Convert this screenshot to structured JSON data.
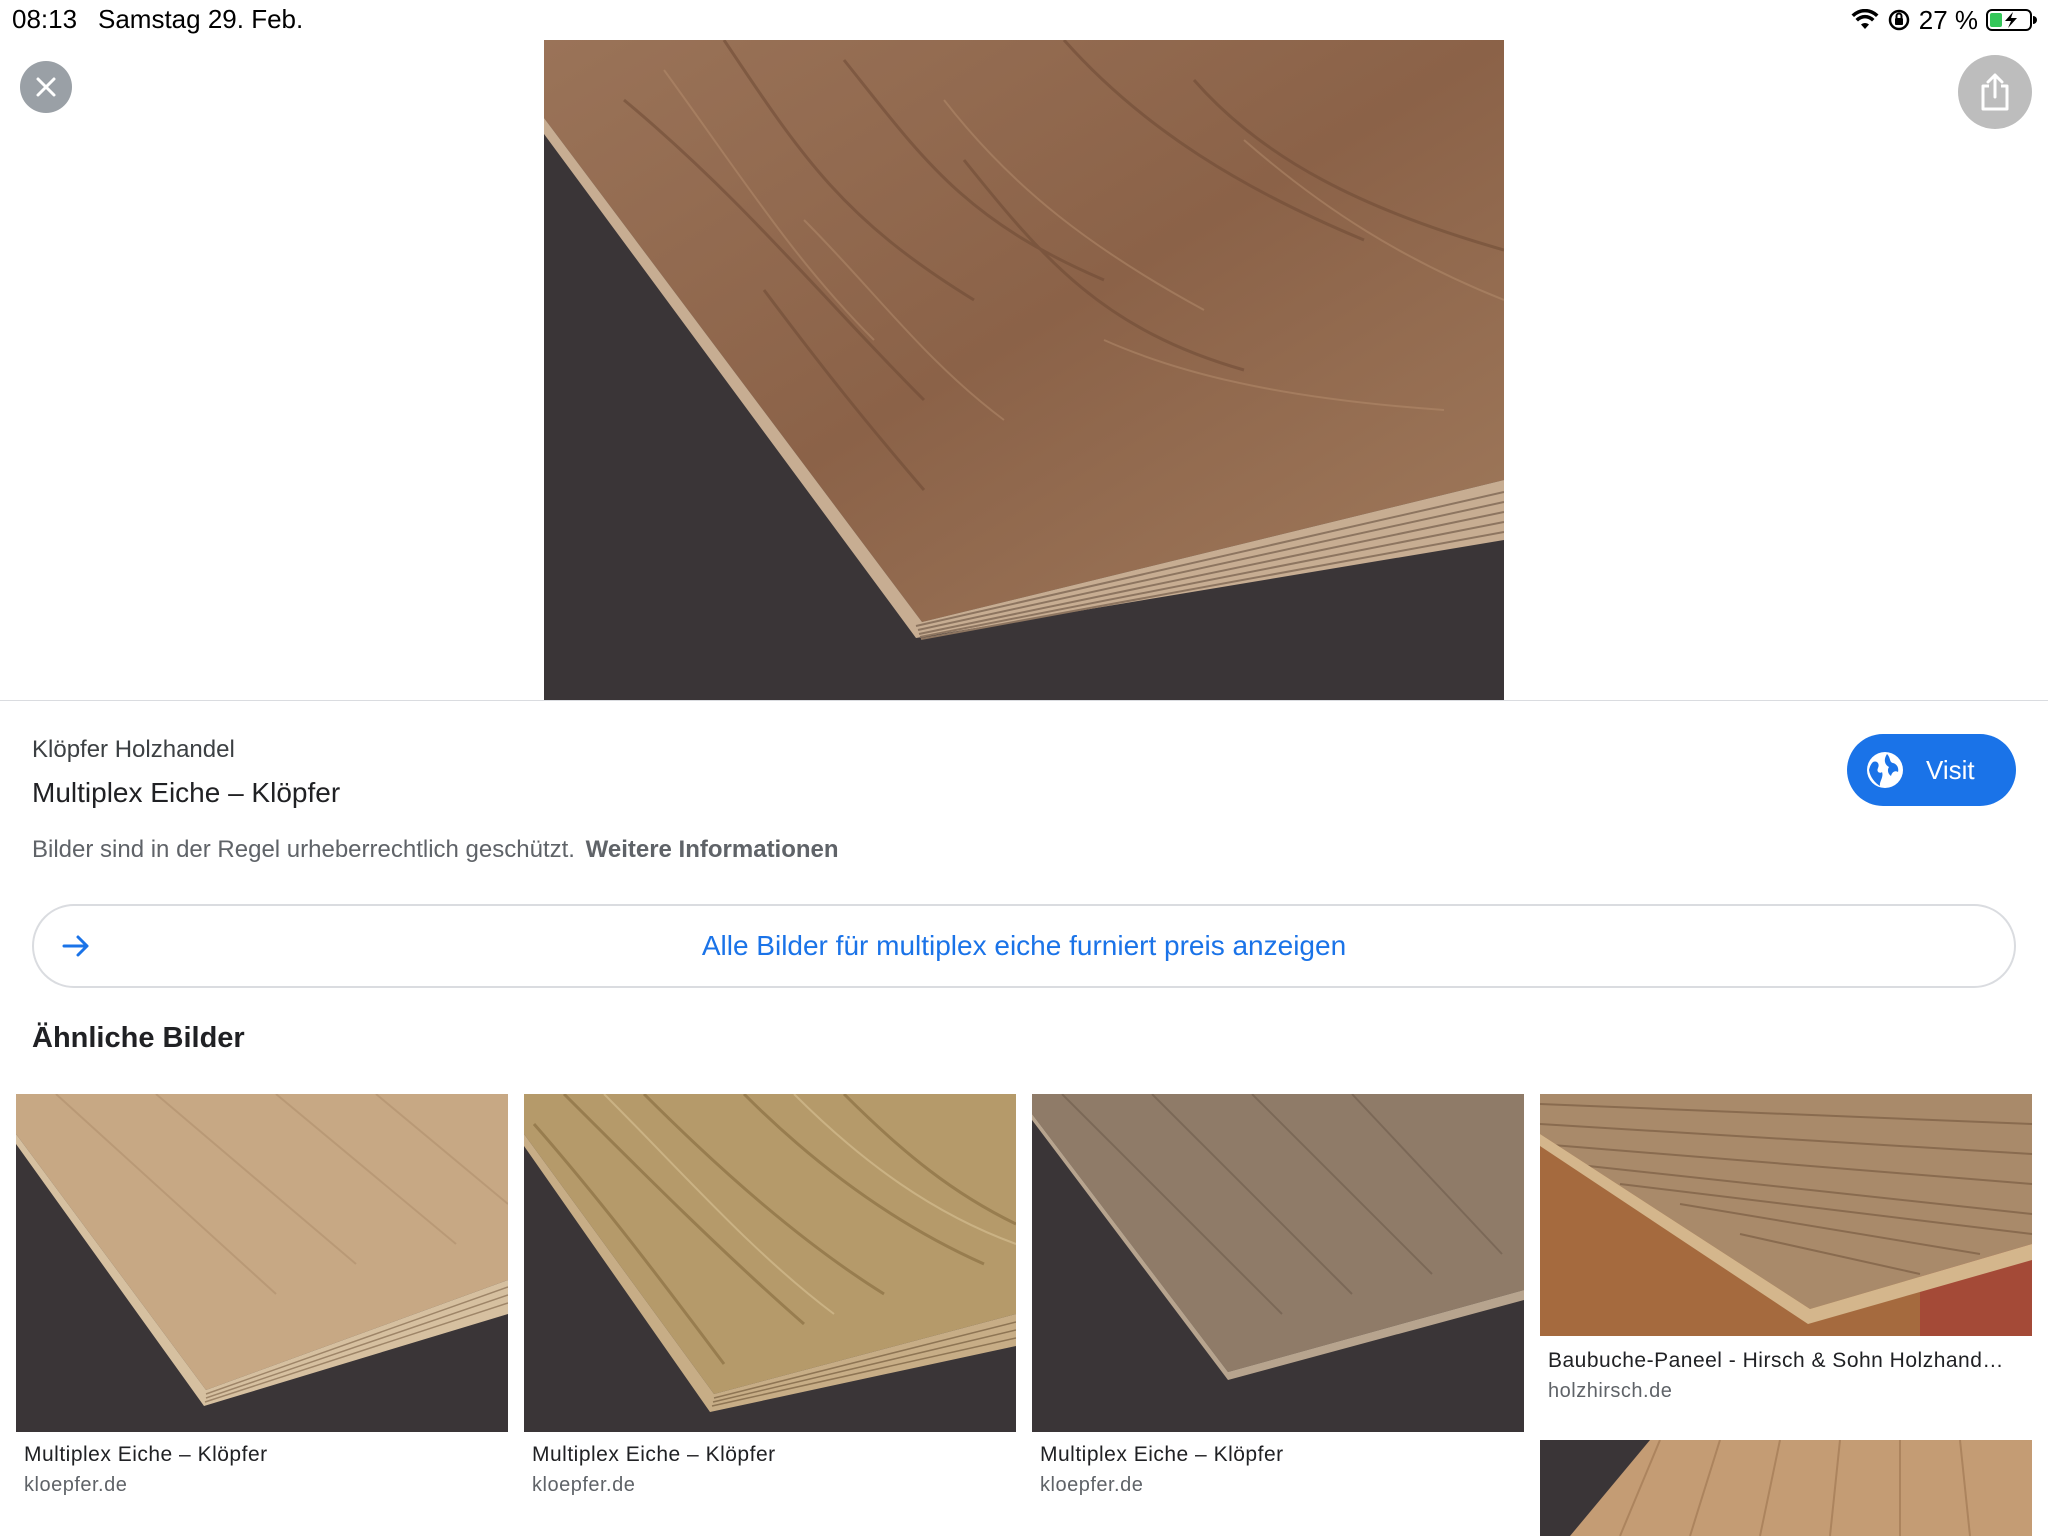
{
  "status_bar": {
    "time": "08:13",
    "date": "Samstag 29. Feb.",
    "battery": "27 %",
    "icons": [
      "wifi-icon",
      "orientation-lock-icon",
      "battery-charging-icon"
    ]
  },
  "viewer": {
    "close_icon": "close-icon",
    "share_icon": "share-icon",
    "main_image_alt": "wood-plank-image"
  },
  "info": {
    "source": "Klöpfer Holzhandel",
    "title": "Multiplex Eiche – Klöpfer",
    "copyright_text": "Bilder sind in der Regel urheberrechtlich geschützt.",
    "copyright_link": "Weitere Informationen",
    "visit_label": "Visit",
    "visit_icon": "globe-icon"
  },
  "all_images": {
    "label": "Alle Bilder für multiplex eiche furniert preis anzeigen",
    "icon": "arrow-right-icon"
  },
  "similar": {
    "heading": "Ähnliche Bilder",
    "items": [
      {
        "title": "Multiplex Eiche – Klöpfer",
        "domain": "kloepfer.de"
      },
      {
        "title": "Multiplex Eiche – Klöpfer",
        "domain": "kloepfer.de"
      },
      {
        "title": "Multiplex Eiche – Klöpfer",
        "domain": "kloepfer.de"
      },
      {
        "title": "Baubuche-Paneel - Hirsch & Sohn Holzhand…",
        "domain": "holzhirsch.de"
      },
      {
        "title": "",
        "domain": ""
      }
    ]
  },
  "colors": {
    "accent": "#1a73e8",
    "wood_dark": "#8a6a52",
    "wood_light": "#c8ab8a",
    "background_dark": "#3a3537"
  }
}
